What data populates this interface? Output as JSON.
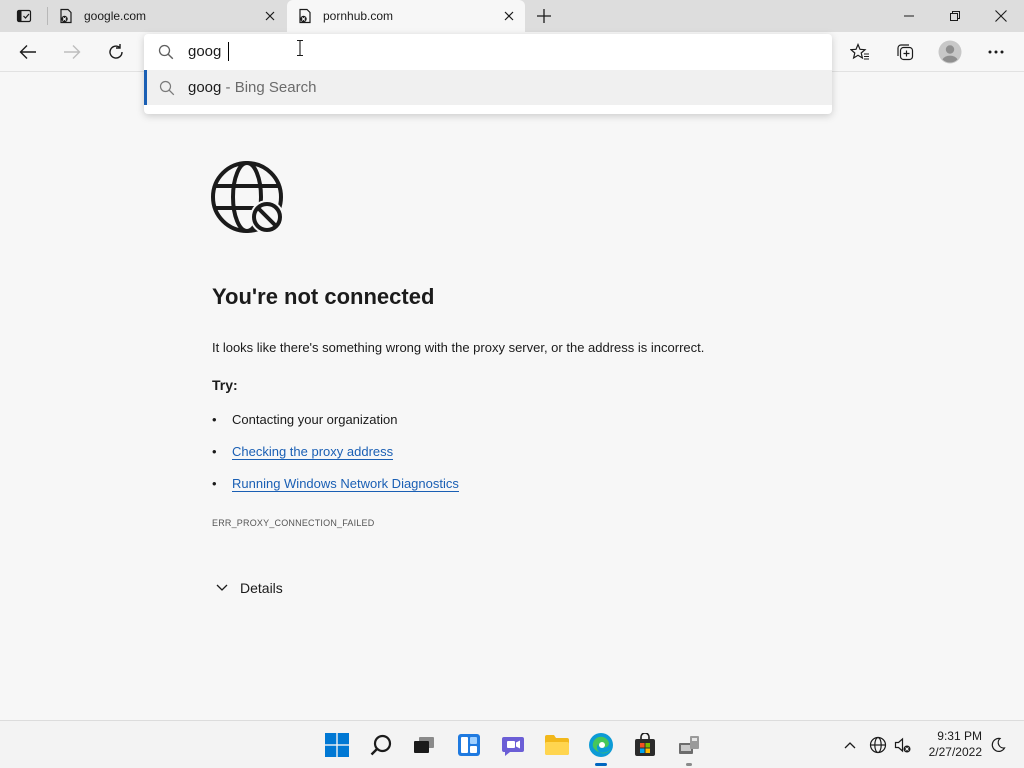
{
  "tabs": [
    {
      "title": "google.com",
      "active": false
    },
    {
      "title": "pornhub.com",
      "active": true
    }
  ],
  "omnibox": {
    "query": "goog",
    "suggestion": {
      "term": "goog",
      "source": " - Bing Search"
    }
  },
  "error_page": {
    "title": "You're not connected",
    "description": "It looks like there's something wrong with the proxy server, or the address is incorrect.",
    "try_label": "Try:",
    "suggestions": [
      {
        "text": "Contacting your organization",
        "is_link": false
      },
      {
        "text": "Checking the proxy address",
        "is_link": true
      },
      {
        "text": "Running Windows Network Diagnostics",
        "is_link": true
      }
    ],
    "error_code": "ERR_PROXY_CONNECTION_FAILED",
    "details_label": "Details"
  },
  "taskbar": {
    "time": "9:31 PM",
    "date": "2/27/2022"
  },
  "colors": {
    "accent": "#1a5fb4",
    "edge_blue": "#0067c0"
  }
}
